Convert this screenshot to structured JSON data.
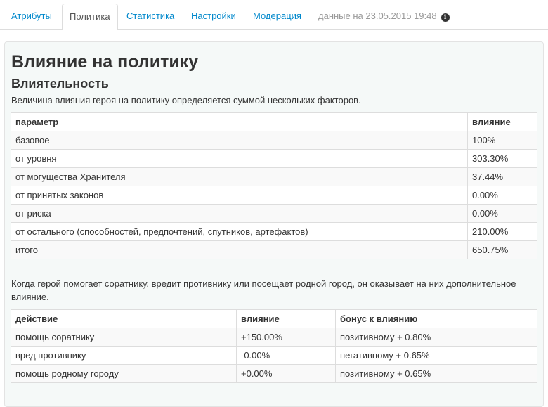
{
  "tabs": [
    {
      "label": "Атрибуты",
      "active": false
    },
    {
      "label": "Политика",
      "active": true
    },
    {
      "label": "Статистика",
      "active": false
    },
    {
      "label": "Настройки",
      "active": false
    },
    {
      "label": "Модерация",
      "active": false
    }
  ],
  "data_date": "данные на 23.05.2015 19:48",
  "info_icon": "info-icon",
  "colors": {
    "link": "#0088cc",
    "panel_bg": "#f5f9f8"
  },
  "page_title": "Влияние на политику",
  "section_title": "Влиятельность",
  "section_desc": "Величина влияния героя на политику определяется суммой нескольких факторов.",
  "factors": {
    "headers": [
      "параметр",
      "влияние"
    ],
    "rows": [
      [
        "базовое",
        "100%"
      ],
      [
        "от уровня",
        "303.30%"
      ],
      [
        "от могущества Хранителя",
        "37.44%"
      ],
      [
        "от принятых законов",
        "0.00%"
      ],
      [
        "от риска",
        "0.00%"
      ],
      [
        "от остального (способностей, предпочтений, спутников, артефактов)",
        "210.00%"
      ],
      [
        "итого",
        "650.75%"
      ]
    ]
  },
  "actions_desc": "Когда герой помогает соратнику, вредит противнику или посещает родной город, он оказывает на них дополнительное влияние.",
  "actions": {
    "headers": [
      "действие",
      "влияние",
      "бонус к влиянию"
    ],
    "rows": [
      [
        "помощь соратнику",
        "+150.00%",
        "позитивному + 0.80%"
      ],
      [
        "вред противнику",
        "-0.00%",
        "негативному + 0.65%"
      ],
      [
        "помощь родному городу",
        "+0.00%",
        "позитивному + 0.65%"
      ]
    ]
  }
}
